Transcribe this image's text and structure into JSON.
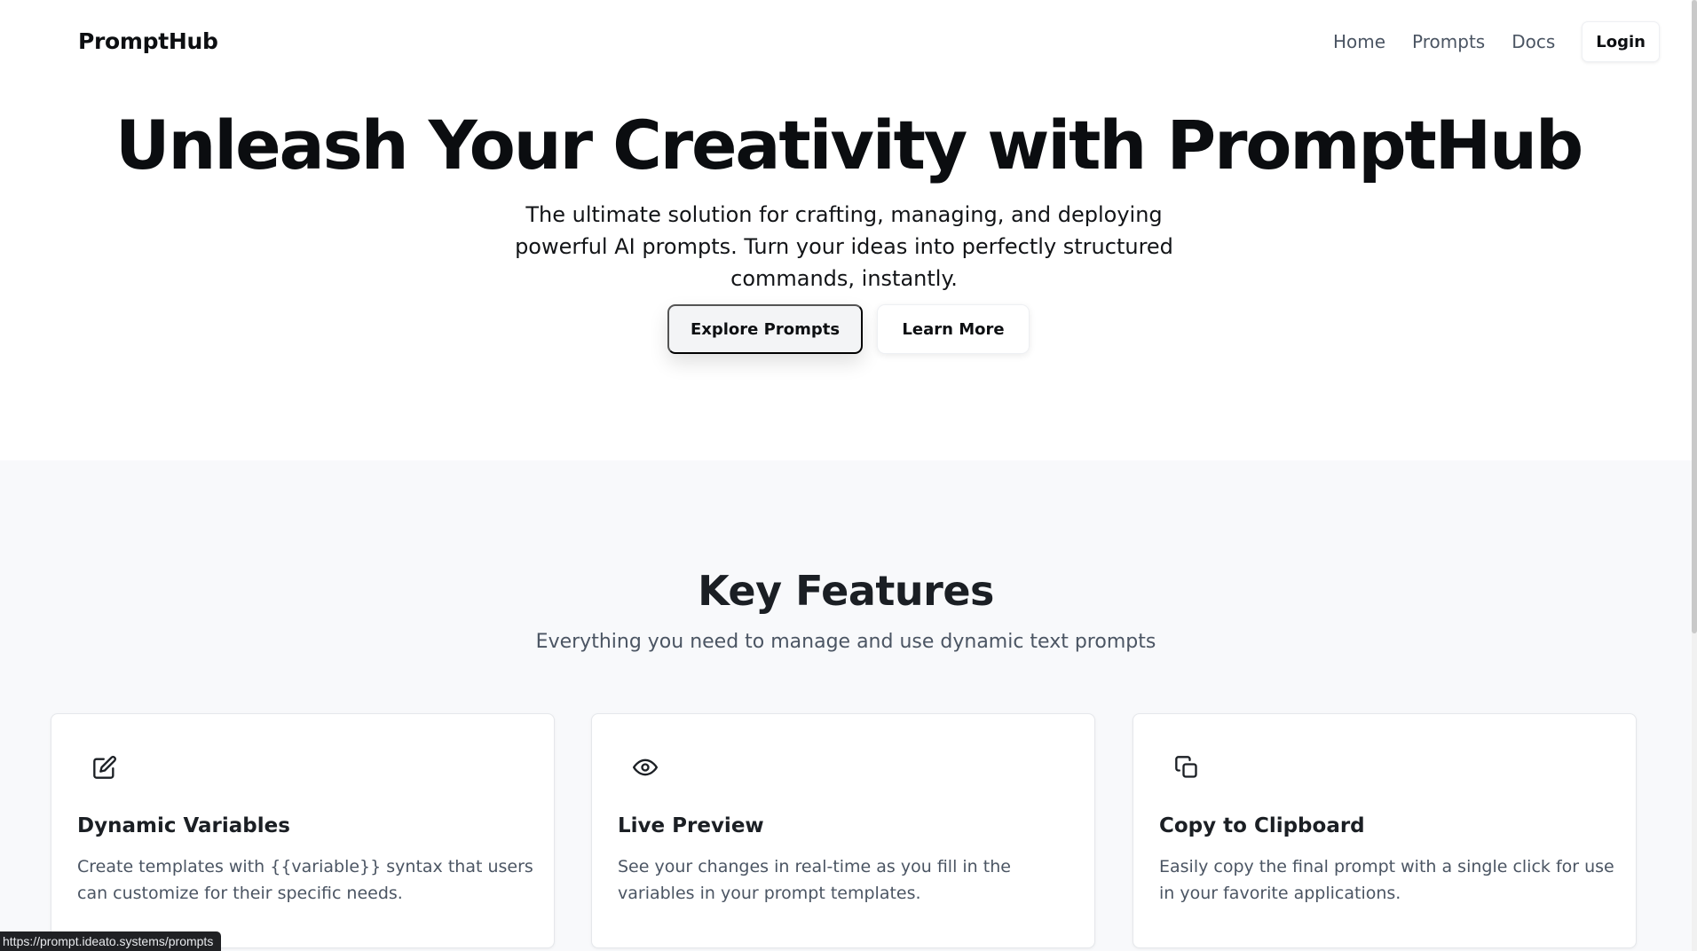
{
  "navbar": {
    "brand": "PromptHub",
    "links": [
      "Home",
      "Prompts",
      "Docs"
    ],
    "login_label": "Login"
  },
  "hero": {
    "title": "Unleash Your Creativity with PromptHub",
    "subtitle": "The ultimate solution for crafting, managing, and deploying powerful AI prompts. Turn your ideas into perfectly structured commands, instantly.",
    "primary_button": "Explore Prompts",
    "secondary_button": "Learn More"
  },
  "features": {
    "title": "Key Features",
    "subtitle": "Everything you need to manage and use dynamic text prompts",
    "cards": [
      {
        "icon": "edit-icon",
        "title": "Dynamic Variables",
        "description": "Create templates with {{variable}} syntax that users can customize for their specific needs."
      },
      {
        "icon": "eye-icon",
        "title": "Live Preview",
        "description": "See your changes in real-time as you fill in the variables in your prompt templates."
      },
      {
        "icon": "copy-icon",
        "title": "Copy to Clipboard",
        "description": "Easily copy the final prompt with a single click for use in your favorite applications."
      }
    ]
  },
  "status_bar": {
    "url": "https://prompt.ideato.systems/prompts"
  }
}
